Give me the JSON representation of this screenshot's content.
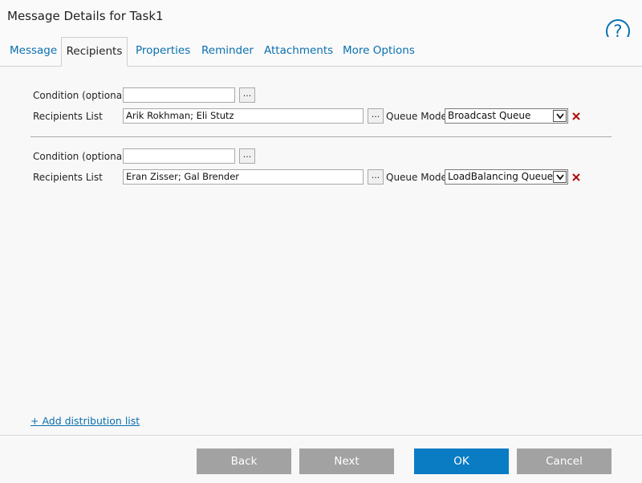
{
  "window": {
    "title": "Message Details for Task1"
  },
  "help": {
    "symbol": "?"
  },
  "tabs": [
    {
      "label": "Message"
    },
    {
      "label": "Recipients"
    },
    {
      "label": "Properties"
    },
    {
      "label": "Reminder"
    },
    {
      "label": "Attachments"
    },
    {
      "label": "More Options"
    }
  ],
  "active_tab": "Recipients",
  "labels": {
    "condition": "Condition (optional)",
    "recipients": "Recipients List",
    "queue_mode": "Queue Mode",
    "browse": "..."
  },
  "groups": [
    {
      "condition": "",
      "recipients": "Arik Rokhman; Eli Stutz",
      "queue_mode": "Broadcast Queue"
    },
    {
      "condition": "",
      "recipients": "Eran Zisser; Gal Brender",
      "queue_mode": "LoadBalancing Queue"
    }
  ],
  "add_link": "+ Add distribution list",
  "footer": {
    "back": "Back",
    "next": "Next",
    "ok": "OK",
    "cancel": "Cancel"
  },
  "colors": {
    "accent": "#0a7cc4",
    "link": "#0a6fb0",
    "disabled_button": "#a2a2a2"
  }
}
